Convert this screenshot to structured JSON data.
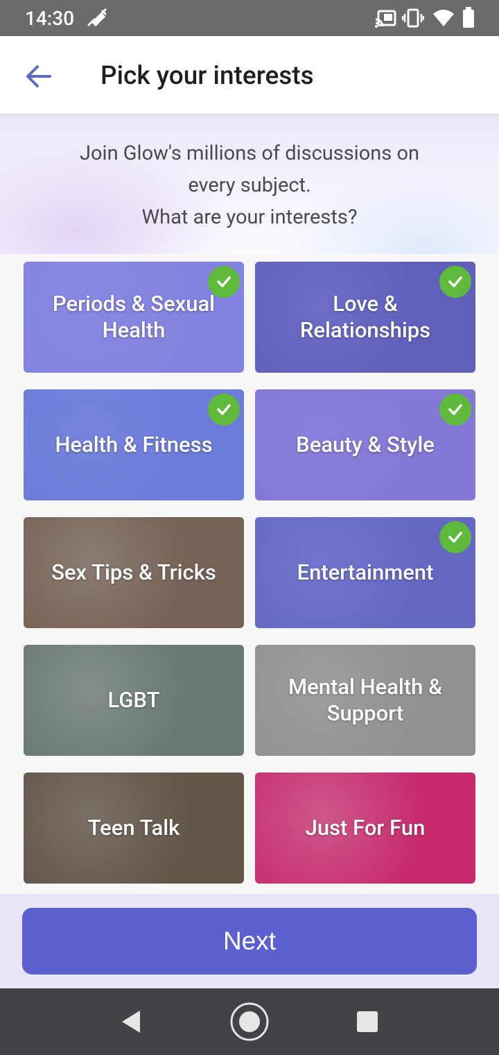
{
  "status_bar": {
    "time": "14:30",
    "icons": [
      "syringe-icon",
      "cast-icon",
      "vibrate-icon",
      "wifi-icon",
      "battery-icon"
    ]
  },
  "app_bar": {
    "back_icon": "arrow-left-icon",
    "title": "Pick your interests"
  },
  "intro": {
    "line1": "Join Glow's millions of discussions on",
    "line2": "every subject.",
    "line3": "What are your interests?"
  },
  "interests": [
    {
      "label": "Periods & Sexual Health",
      "selected": true,
      "bg": "#c9b8e8",
      "overlay": "rgba(106,110,220,0.72)"
    },
    {
      "label": "Love & Relationships",
      "selected": true,
      "bg": "#4a3f6a",
      "overlay": "rgba(106,110,220,0.72)"
    },
    {
      "label": "Health & Fitness",
      "selected": true,
      "bg": "#6f9fd6",
      "overlay": "rgba(106,110,220,0.70)"
    },
    {
      "label": "Beauty & Style",
      "selected": true,
      "bg": "#c090c8",
      "overlay": "rgba(106,110,220,0.70)"
    },
    {
      "label": "Sex Tips & Tricks",
      "selected": false,
      "bg": "#8a7060",
      "overlay": "rgba(60,50,50,0.25)"
    },
    {
      "label": "Entertainment",
      "selected": true,
      "bg": "#5a5d8a",
      "overlay": "rgba(106,110,220,0.70)"
    },
    {
      "label": "LGBT",
      "selected": false,
      "bg": "#7a8c84",
      "overlay": "rgba(40,40,40,0.20)"
    },
    {
      "label": "Mental Health & Support",
      "selected": false,
      "bg": "#b0b0b0",
      "overlay": "rgba(90,90,90,0.35)"
    },
    {
      "label": "Teen Talk",
      "selected": false,
      "bg": "#7c6a58",
      "overlay": "rgba(40,40,40,0.30)"
    },
    {
      "label": "Just For Fun",
      "selected": false,
      "bg": "#e0307a",
      "overlay": "rgba(60,20,40,0.15)"
    }
  ],
  "footer": {
    "next_label": "Next"
  },
  "nav_bar": {
    "icons": [
      "back-triangle-icon",
      "home-circle-icon",
      "recents-square-icon"
    ]
  },
  "colors": {
    "accent": "#5c5fd0",
    "check": "#5fb93a",
    "back_arrow": "#5c6bc0"
  }
}
